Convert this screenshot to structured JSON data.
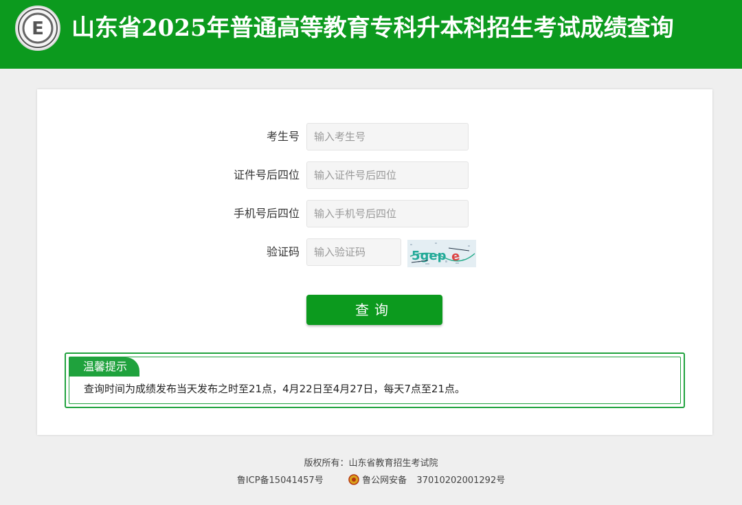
{
  "header": {
    "title": "山东省2025年普通高等教育专科升本科招生考试成绩查询",
    "logo_letter": "E",
    "bg_color": "#0c9a1e"
  },
  "form": {
    "exam_no": {
      "label": "考生号",
      "placeholder": "输入考生号"
    },
    "id_last4": {
      "label": "证件号后四位",
      "placeholder": "输入证件号后四位"
    },
    "phone_last4": {
      "label": "手机号后四位",
      "placeholder": "输入手机号后四位"
    },
    "captcha": {
      "label": "验证码",
      "placeholder": "输入验证码",
      "image_text": "5gep"
    },
    "submit_label": "查询"
  },
  "notice": {
    "title": "温馨提示",
    "text": "查询时间为成绩发布当天发布之时至21点，4月22日至4月27日，每天7点至21点。"
  },
  "footer": {
    "copyright": "版权所有：山东省教育招生考试院",
    "icp": "鲁ICP备15041457号",
    "police_label": "鲁公网安备",
    "police_number": "37010202001292号"
  },
  "colors": {
    "accent": "#0c9a1e",
    "notice_border": "#1fa23d"
  }
}
